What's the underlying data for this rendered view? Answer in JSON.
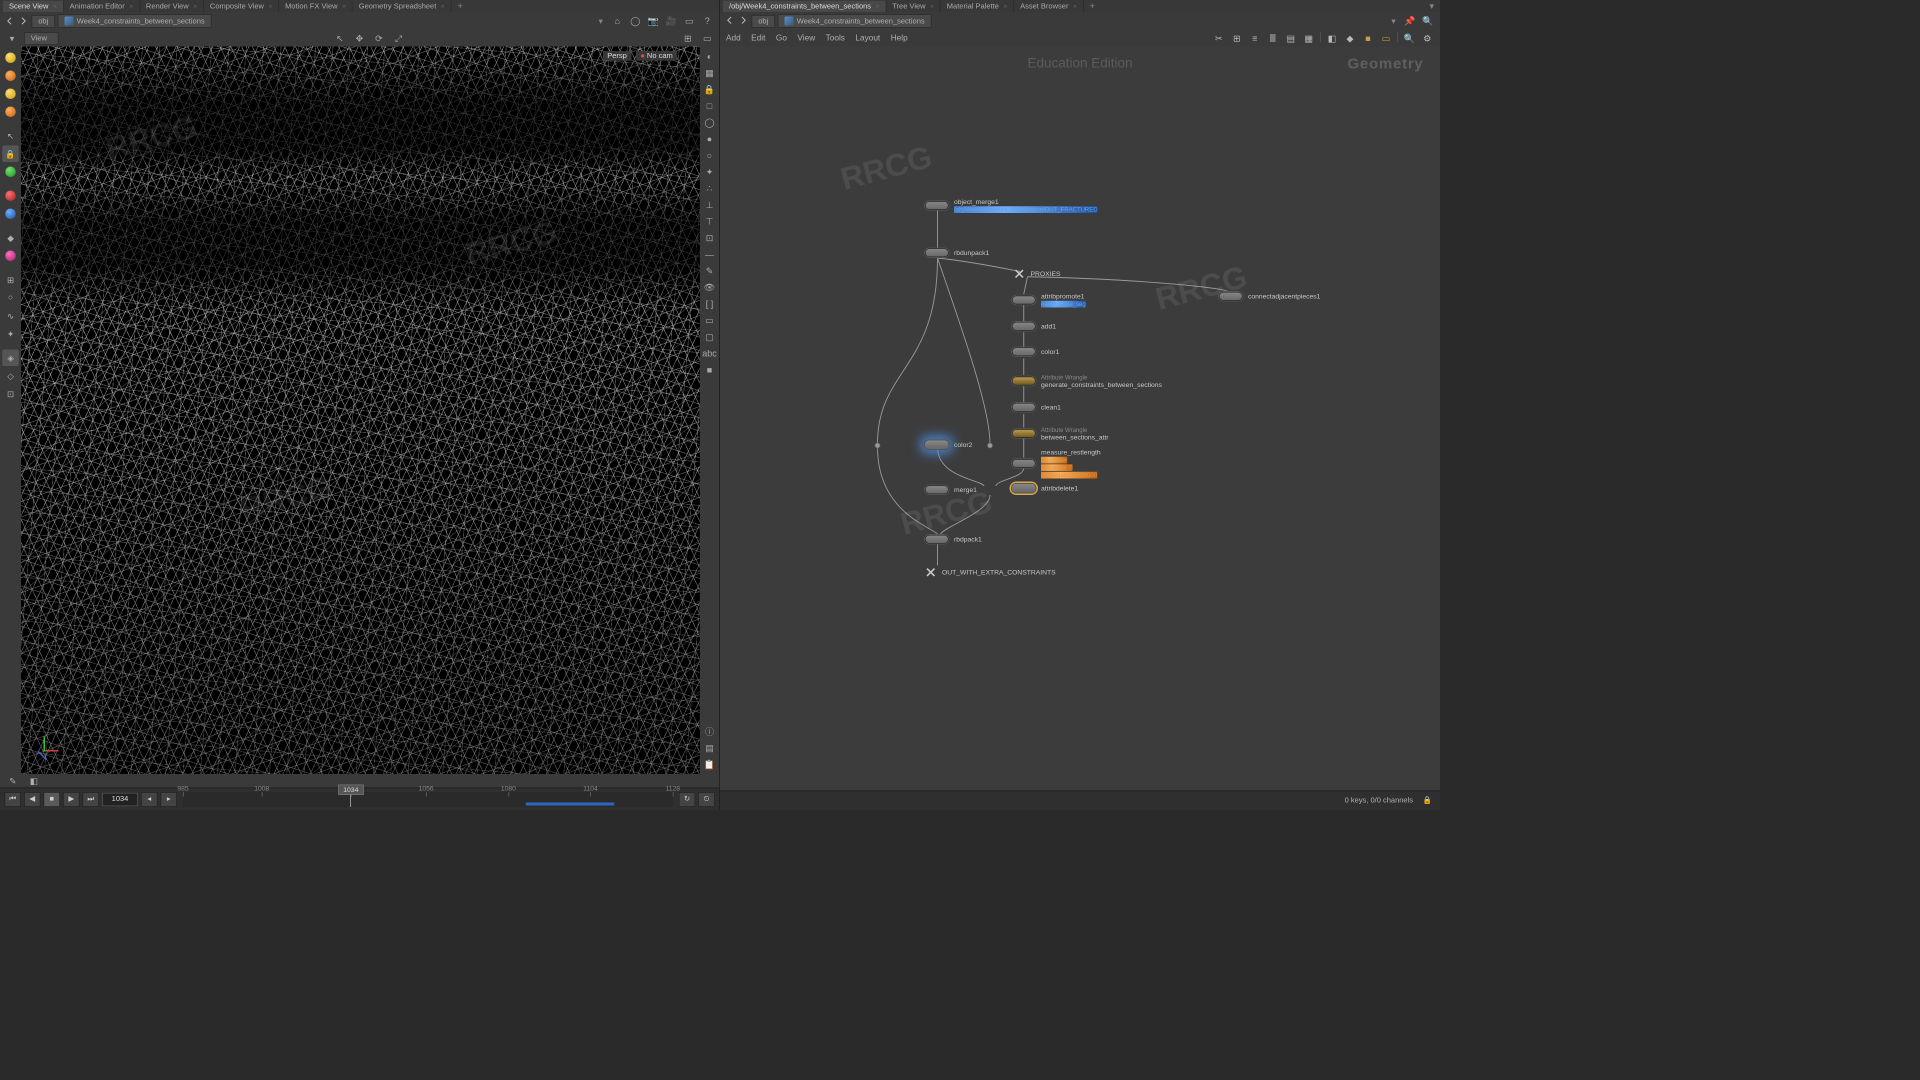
{
  "left": {
    "tabs": [
      {
        "label": "Scene View",
        "active": true
      },
      {
        "label": "Animation Editor"
      },
      {
        "label": "Render View"
      },
      {
        "label": "Composite View"
      },
      {
        "label": "Motion FX View"
      },
      {
        "label": "Geometry Spreadsheet"
      }
    ],
    "path": {
      "segments": [
        "obj",
        "Week4_constraints_between_sections"
      ]
    },
    "view_label": "View",
    "viewport": {
      "persp_label": "Persp",
      "cam_label": "No cam"
    },
    "playbar": {
      "frame": "1034",
      "ticks": [
        985,
        1008,
        1034,
        1056,
        1080,
        1104,
        1128
      ],
      "cached_range_pct": [
        70,
        88
      ]
    }
  },
  "right": {
    "tabs": [
      {
        "label": "/obj/Week4_constraints_between_sections"
      },
      {
        "label": "Tree View"
      },
      {
        "label": "Material Palette"
      },
      {
        "label": "Asset Browser"
      }
    ],
    "path": {
      "segments": [
        "obj",
        "Week4_constraints_between_sections"
      ]
    },
    "menu": [
      "Add",
      "Edit",
      "Go",
      "View",
      "Tools",
      "Layout",
      "Help"
    ],
    "watermark_edu": "Education Edition",
    "watermark_geo": "Geometry",
    "status": "0 keys, 0/0 channels",
    "nodes": {
      "object_merge1": {
        "label": "object_merge1",
        "sub": "/obj/Week4_fracture_optimization/OUT_FRACTURED"
      },
      "rbdunpack1": {
        "label": "rbdunpack1"
      },
      "proxies": {
        "label": "PROXIES"
      },
      "attribpromote1": {
        "label": "attribpromote1",
        "sub": "name name_seg"
      },
      "connectadjacentpieces1": {
        "label": "connectadjacentpieces1"
      },
      "add1": {
        "label": "add1"
      },
      "color1": {
        "label": "color1"
      },
      "wrangle_gen": {
        "wr": "Attribute Wrangle",
        "label": "generate_constraints_between_sections"
      },
      "clean1": {
        "label": "clean1"
      },
      "wrangle_attr": {
        "wr": "Attribute Wrangle",
        "label": "between_sections_attr"
      },
      "measure": {
        "label": "measure_restlength",
        "info1": "Perimeter",
        "info2": "Elements: 0",
        "info3": "Aggregate: 0.000000"
      },
      "color2": {
        "label": "color2"
      },
      "attribdelete1": {
        "label": "attribdelete1"
      },
      "merge1": {
        "label": "merge1"
      },
      "rbdpack1": {
        "label": "rbdpack1"
      },
      "out": {
        "label": "OUT_WITH_EXTRA_CONSTRAINTS"
      }
    }
  }
}
